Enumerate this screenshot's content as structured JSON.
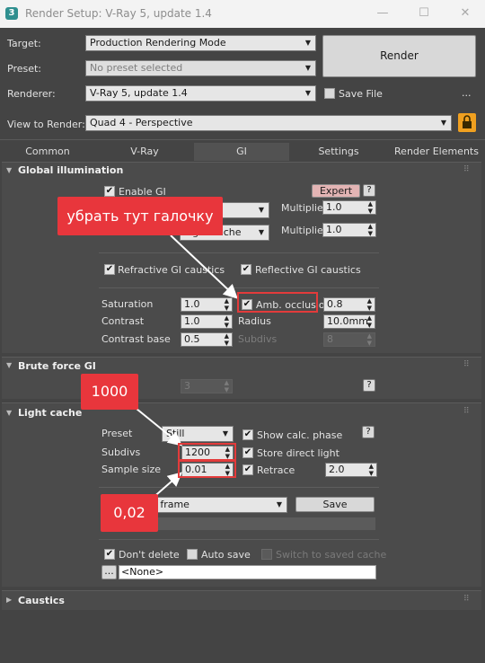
{
  "window": {
    "title": "Render Setup: V-Ray 5, update 1.4",
    "app_icon": "3",
    "minimize_glyph": "—",
    "maximize_glyph": "☐",
    "close_glyph": "✕"
  },
  "header": {
    "target_label": "Target:",
    "target_value": "Production Rendering Mode",
    "preset_label": "Preset:",
    "preset_value": "No preset selected",
    "renderer_label": "Renderer:",
    "renderer_value": "V-Ray 5, update 1.4",
    "save_file_label": "Save File",
    "dots": "...",
    "view_label": "View to Render:",
    "view_value": "Quad 4 - Perspective",
    "render_button": "Render"
  },
  "tabs": [
    {
      "label": "Common",
      "active": false
    },
    {
      "label": "V-Ray",
      "active": false
    },
    {
      "label": "GI",
      "active": true
    },
    {
      "label": "Settings",
      "active": false
    },
    {
      "label": "Render Elements",
      "active": false
    }
  ],
  "gi": {
    "title": "Global illumination",
    "enable_gi_label": "Enable GI",
    "expert_label": "Expert",
    "help": "?",
    "primary_engine": "ce",
    "secondary_engine": "Light cache",
    "multiplier_label": "Multiplier",
    "primary_multiplier": "1.0",
    "secondary_multiplier": "1.0",
    "refractive_label": "Refractive GI caustics",
    "reflective_label": "Reflective GI caustics",
    "saturation_label": "Saturation",
    "saturation_value": "1.0",
    "amb_occlusion_label": "Amb. occlusion",
    "amb_occlusion_value": "0.8",
    "contrast_label": "Contrast",
    "contrast_value": "1.0",
    "radius_label": "Radius",
    "radius_value": "10.0mm",
    "contrast_base_label": "Contrast base",
    "contrast_base_value": "0.5",
    "subdivs_label": "Subdivs",
    "subdivs_value": "8"
  },
  "brute_force": {
    "title": "Brute force GI",
    "bounces_value": "3",
    "help": "?"
  },
  "light_cache": {
    "title": "Light cache",
    "preset_label": "Preset",
    "preset_value": "Still",
    "show_calc_label": "Show calc. phase",
    "help": "?",
    "subdivs_label": "Subdivs",
    "subdivs_value": "1200",
    "store_direct_label": "Store direct light",
    "sample_size_label": "Sample size",
    "sample_size_value": "0.01",
    "retrace_label": "Retrace",
    "retrace_value": "2.0",
    "mode_value": "le frame",
    "save_button": "Save",
    "dont_delete_label": "Don't delete",
    "auto_save_label": "Auto save",
    "switch_label": "Switch to saved cache",
    "browse_button": "...",
    "file_value": "<None>"
  },
  "caustics": {
    "title": "Caustics"
  },
  "annotations": {
    "remove_checkbox": "убрать тут галочку",
    "subdivs_note": "1000",
    "sample_note": "0,02"
  },
  "colors": {
    "annotation_red": "#e8363c",
    "panel_bg": "#444444",
    "lock_orange": "#f0a020",
    "expert_pink": "#e3b4b4"
  }
}
